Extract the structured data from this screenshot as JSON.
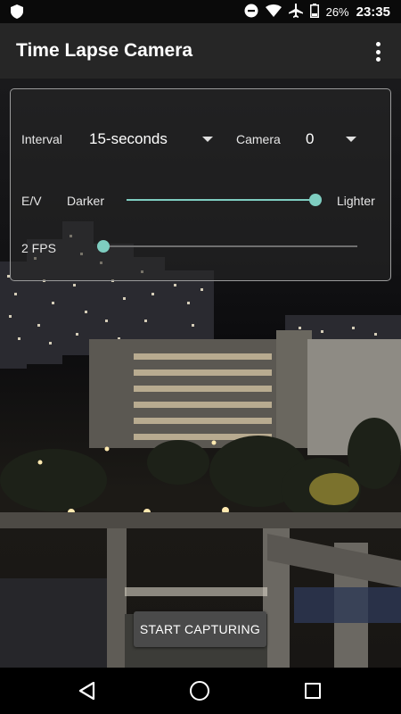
{
  "status_bar": {
    "battery": "26%",
    "time": "23:35",
    "icons": [
      "shield-icon",
      "do-not-disturb-icon",
      "wifi-icon",
      "airplane-icon",
      "battery-icon"
    ]
  },
  "app_bar": {
    "title": "Time Lapse Camera",
    "menu_icon": "more-vert-icon"
  },
  "controls": {
    "interval_label": "Interval",
    "interval_value": "15-seconds",
    "camera_label": "Camera",
    "camera_value": "0",
    "ev_label": "E/V",
    "ev_min_label": "Darker",
    "ev_max_label": "Lighter",
    "ev_level": 1.0,
    "fps_label": "2 FPS",
    "fps_level": 0.0
  },
  "capture_button": {
    "label": "START CAPTURING"
  },
  "nav_bar": {
    "icons": [
      "back-icon",
      "home-icon",
      "recents-icon"
    ]
  },
  "colors": {
    "accent": "#7ecdc0",
    "app_bar": "#262626",
    "button": "#4a4a4a"
  }
}
